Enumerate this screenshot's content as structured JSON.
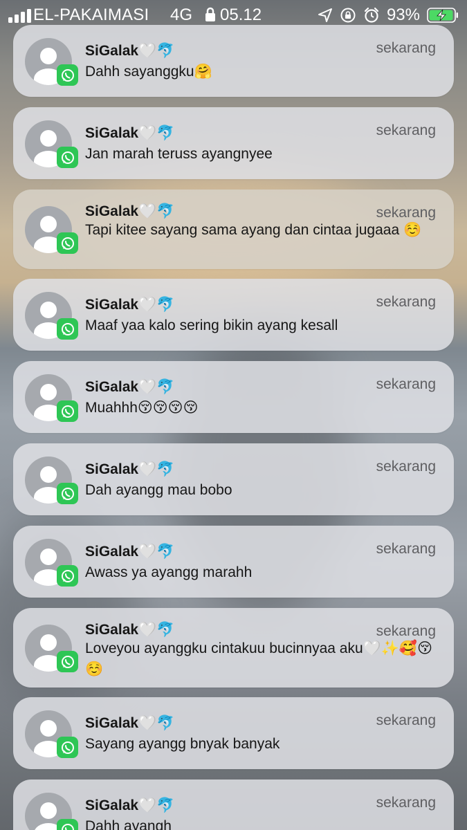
{
  "status_bar": {
    "carrier": "EL-PAKAIMASI",
    "network": "4G",
    "time": "05.12",
    "battery": "93%"
  },
  "notifications": [
    {
      "sender": "SiGalak🤍🐬",
      "time": "sekarang",
      "message": "Dahh sayanggku🤗"
    },
    {
      "sender": "SiGalak🤍🐬",
      "time": "sekarang",
      "message": "Jan marah teruss ayangnyee"
    },
    {
      "sender": "SiGalak🤍🐬",
      "time": "sekarang",
      "message": "Tapi kitee sayang sama ayang dan cintaa jugaaa ☺️"
    },
    {
      "sender": "SiGalak🤍🐬",
      "time": "sekarang",
      "message": "Maaf yaa kalo sering bikin ayang kesall"
    },
    {
      "sender": "SiGalak🤍🐬",
      "time": "sekarang",
      "message": "Muahhh😚😚😚😚"
    },
    {
      "sender": "SiGalak🤍🐬",
      "time": "sekarang",
      "message": "Dah ayangg mau bobo"
    },
    {
      "sender": "SiGalak🤍🐬",
      "time": "sekarang",
      "message": "Awass ya ayangg marahh"
    },
    {
      "sender": "SiGalak🤍🐬",
      "time": "sekarang",
      "message": "Loveyou ayanggku cintakuu bucinnyaa aku🤍✨🥰😚☺️"
    },
    {
      "sender": "SiGalak🤍🐬",
      "time": "sekarang",
      "message": "Sayang ayangg bnyak banyak"
    },
    {
      "sender": "SiGalak🤍🐬",
      "time": "sekarang",
      "message": "Dahh ayangh"
    }
  ],
  "colors": {
    "whatsapp_green": "#2ec655",
    "card_background": "#dee0e4"
  }
}
